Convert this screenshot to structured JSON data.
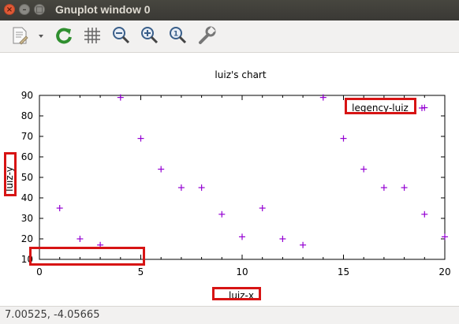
{
  "window": {
    "title": "Gnuplot window 0"
  },
  "toolbar": {
    "items": [
      {
        "name": "export-icon",
        "label": ""
      },
      {
        "name": "replot-icon",
        "label": ""
      },
      {
        "name": "grid-icon",
        "label": ""
      },
      {
        "name": "zoom-out-icon",
        "label": ""
      },
      {
        "name": "zoom-in-icon",
        "label": ""
      },
      {
        "name": "zoom-reset-icon",
        "label": ""
      },
      {
        "name": "settings-icon",
        "label": ""
      }
    ]
  },
  "status": {
    "coords": "7.00525, -4.05665"
  },
  "chart_data": {
    "type": "scatter",
    "title": "luiz's chart",
    "xlabel": "luiz-x",
    "ylabel": "luiz-y",
    "xlim": [
      0,
      20
    ],
    "ylim": [
      10,
      90
    ],
    "xticks": [
      0,
      5,
      10,
      15,
      20
    ],
    "yticks": [
      10,
      20,
      30,
      40,
      50,
      60,
      70,
      80,
      90
    ],
    "legend": "top-right",
    "marker": "+",
    "color": "#9400d3",
    "series": [
      {
        "name": "legency-luiz",
        "x": [
          1,
          2,
          3,
          4,
          5,
          6,
          7,
          8,
          9,
          10,
          11,
          12,
          13,
          14,
          15,
          16,
          17,
          18,
          19,
          20
        ],
        "y": [
          35,
          20,
          17,
          89,
          69,
          54,
          45,
          45,
          32,
          21,
          35,
          20,
          17,
          89,
          69,
          54,
          45,
          45,
          32,
          21
        ],
        "extra": [
          [
            19,
            84
          ]
        ]
      }
    ]
  },
  "colors": {
    "annotation": "#d71414",
    "marker": "#9400d3"
  }
}
